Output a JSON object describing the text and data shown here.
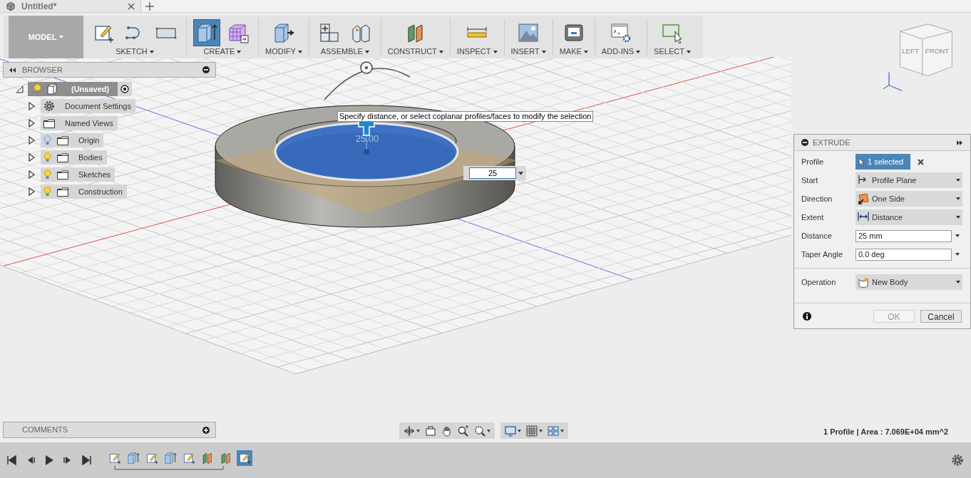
{
  "document_tab": {
    "title": "Untitled*"
  },
  "toolbar": {
    "workspace": "MODEL",
    "groups": [
      {
        "label": "SKETCH",
        "tools": [
          {
            "kind": "sketch",
            "selected": false
          },
          {
            "kind": "arc",
            "selected": false
          },
          {
            "kind": "rectangle",
            "selected": false
          }
        ]
      },
      {
        "label": "CREATE",
        "tools": [
          {
            "kind": "extrude",
            "selected": true
          },
          {
            "kind": "form",
            "selected": false
          }
        ]
      },
      {
        "label": "MODIFY",
        "tools": [
          {
            "kind": "presspull",
            "selected": false
          }
        ]
      },
      {
        "label": "ASSEMBLE",
        "tools": [
          {
            "kind": "component",
            "selected": false
          },
          {
            "kind": "joint",
            "selected": false
          }
        ]
      },
      {
        "label": "CONSTRUCT",
        "tools": [
          {
            "kind": "plane",
            "selected": false
          }
        ]
      },
      {
        "label": "INSPECT",
        "tools": [
          {
            "kind": "measure",
            "selected": false
          }
        ]
      },
      {
        "label": "INSERT",
        "tools": [
          {
            "kind": "image",
            "selected": false
          }
        ]
      },
      {
        "label": "MAKE",
        "tools": [
          {
            "kind": "print",
            "selected": false
          }
        ]
      },
      {
        "label": "ADD-INS",
        "tools": [
          {
            "kind": "scripts",
            "selected": false
          }
        ]
      },
      {
        "label": "SELECT",
        "tools": [
          {
            "kind": "select",
            "selected": false
          }
        ]
      }
    ]
  },
  "browser": {
    "title": "BROWSER",
    "root": {
      "label": "(Unsaved)",
      "expanded": true,
      "visible": true,
      "children": [
        {
          "label": "Document Settings",
          "kind": "settings",
          "expanded": false
        },
        {
          "label": "Named Views",
          "kind": "folder",
          "expanded": false
        },
        {
          "label": "Origin",
          "kind": "folder",
          "expanded": false,
          "visible": false
        },
        {
          "label": "Bodies",
          "kind": "folder",
          "expanded": false,
          "visible": true
        },
        {
          "label": "Sketches",
          "kind": "folder",
          "expanded": false,
          "visible": true
        },
        {
          "label": "Construction",
          "kind": "folder",
          "expanded": false,
          "visible": true
        }
      ]
    }
  },
  "viewport": {
    "tooltip": "Specify distance, or select coplanar profiles/faces to modify the selection",
    "dimension_label": "25.00",
    "distance_input": "25",
    "viewcube": {
      "left": "LEFT",
      "front": "FRONT"
    }
  },
  "extrude_panel": {
    "title": "EXTRUDE",
    "rows": [
      {
        "kind": "selection",
        "label": "Profile",
        "value": "1 selected",
        "separated": false
      },
      {
        "kind": "dropdown",
        "label": "Start",
        "value": "Profile Plane",
        "separated": false
      },
      {
        "kind": "dropdown",
        "label": "Direction",
        "value": "One Side",
        "separated": false
      },
      {
        "kind": "dropdown",
        "label": "Extent",
        "value": "Distance",
        "separated": false
      },
      {
        "kind": "input",
        "label": "Distance",
        "value": "25 mm",
        "separated": false
      },
      {
        "kind": "input",
        "label": "Taper Angle",
        "value": "0.0 deg",
        "separated": false
      },
      {
        "kind": "dropdown",
        "label": "Operation",
        "value": "New Body",
        "separated": true
      }
    ],
    "buttons": [
      {
        "label": "OK",
        "disabled": true
      },
      {
        "label": "Cancel",
        "disabled": false
      }
    ]
  },
  "comments": {
    "title": "COMMENTS"
  },
  "status": "1 Profile | Area : 7.069E+04 mm^2",
  "timeline": {
    "features": [
      {
        "kind": "sketch",
        "selected": false
      },
      {
        "kind": "extrude",
        "selected": false
      },
      {
        "kind": "sketch",
        "selected": false
      },
      {
        "kind": "extrude",
        "selected": false
      },
      {
        "kind": "sketch",
        "selected": false
      },
      {
        "kind": "plane",
        "selected": false
      },
      {
        "kind": "plane",
        "selected": false
      },
      {
        "kind": "sketch",
        "selected": true
      }
    ]
  }
}
